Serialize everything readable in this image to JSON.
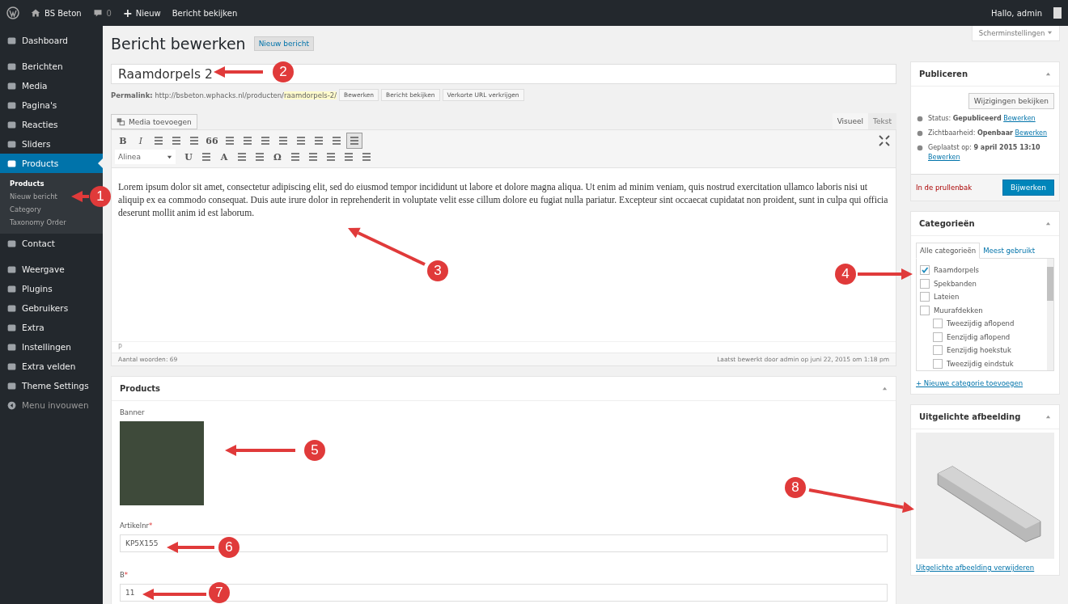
{
  "admin_bar": {
    "site": "BS Beton",
    "comments": "0",
    "plus": "+",
    "new": "Nieuw",
    "view": "Bericht bekijken",
    "greeting": "Hallo, admin"
  },
  "sidebar": {
    "items": [
      {
        "label": "Dashboard",
        "selected": false
      },
      {
        "label": "Berichten",
        "selected": false
      },
      {
        "label": "Media",
        "selected": false
      },
      {
        "label": "Pagina's",
        "selected": false
      },
      {
        "label": "Reacties",
        "selected": false
      },
      {
        "label": "Sliders",
        "selected": false
      },
      {
        "label": "Products",
        "selected": true,
        "children": [
          {
            "label": "Products",
            "selected": true
          },
          {
            "label": "Nieuw bericht",
            "selected": false
          },
          {
            "label": "Category",
            "selected": false
          },
          {
            "label": "Taxonomy Order",
            "selected": false
          }
        ]
      },
      {
        "label": "Contact",
        "selected": false
      },
      {
        "label": "Weergave",
        "selected": false
      },
      {
        "label": "Plugins",
        "selected": false
      },
      {
        "label": "Gebruikers",
        "selected": false
      },
      {
        "label": "Extra",
        "selected": false
      },
      {
        "label": "Instellingen",
        "selected": false
      },
      {
        "label": "Extra velden",
        "selected": false
      },
      {
        "label": "Theme Settings",
        "selected": false
      }
    ],
    "collapse": "Menu invouwen"
  },
  "screen_options": "Scherminstellingen",
  "page_title": "Bericht bewerken",
  "new_post_button": "Nieuw bericht",
  "post_title": "Raamdorpels 2",
  "permalink": {
    "label": "Permalink:",
    "base": "http://bsbeton.wphacks.nl/producten/",
    "slug": "raamdorpels-2/",
    "buttons": [
      "Bewerken",
      "Bericht bekijken",
      "Verkorte URL verkrijgen"
    ]
  },
  "media_button": "Media toevoegen",
  "editor_tabs": [
    {
      "label": "Visueel",
      "selected": true
    },
    {
      "label": "Tekst",
      "selected": false
    }
  ],
  "toolbar_rows": [
    [
      {
        "kind": "glyph",
        "label": "B",
        "pressed": false
      },
      {
        "kind": "glyph",
        "label": "I",
        "pressed": false
      },
      {
        "kind": "icon",
        "pressed": false
      },
      {
        "kind": "icon",
        "pressed": false
      },
      {
        "kind": "icon",
        "pressed": false
      },
      {
        "kind": "glyph",
        "label": "66",
        "pressed": false
      },
      {
        "kind": "icon",
        "pressed": false
      },
      {
        "kind": "icon",
        "pressed": false
      },
      {
        "kind": "icon",
        "pressed": false
      },
      {
        "kind": "icon",
        "pressed": false
      },
      {
        "kind": "icon",
        "pressed": false
      },
      {
        "kind": "icon",
        "pressed": false
      },
      {
        "kind": "icon",
        "pressed": false
      },
      {
        "kind": "icon",
        "pressed": true
      }
    ],
    [
      {
        "kind": "select",
        "label": "Alinea"
      },
      {
        "kind": "glyph",
        "label": "U",
        "pressed": false
      },
      {
        "kind": "icon",
        "pressed": false
      },
      {
        "kind": "glyph",
        "label": "A",
        "pressed": false
      },
      {
        "kind": "icon",
        "pressed": false
      },
      {
        "kind": "icon",
        "pressed": false
      },
      {
        "kind": "glyph",
        "label": "Ω",
        "pressed": false
      },
      {
        "kind": "icon",
        "pressed": false
      },
      {
        "kind": "icon",
        "pressed": false
      },
      {
        "kind": "icon",
        "pressed": false
      },
      {
        "kind": "icon",
        "pressed": false
      },
      {
        "kind": "icon",
        "pressed": false
      }
    ]
  ],
  "content": "Lorem ipsum dolor sit amet, consectetur adipiscing elit, sed do eiusmod tempor incididunt ut labore et dolore magna aliqua. Ut enim ad minim veniam, quis nostrud exercitation ullamco laboris nisi ut aliquip ex ea commodo consequat. Duis aute irure dolor in reprehenderit in voluptate velit esse cillum dolore eu fugiat nulla pariatur. Excepteur sint occaecat cupidatat non proident, sunt in culpa qui officia deserunt mollit anim id est laborum.",
  "editor_path": "P",
  "word_count": "Aantal woorden: 69",
  "last_edited": "Laatst bewerkt door admin op juni 22, 2015 om 1:18 pm",
  "products_box": {
    "title": "Products",
    "banner_label": "Banner",
    "fields": [
      {
        "label": "Artikelnr",
        "required_mark": "*",
        "value": "KP5X155"
      },
      {
        "label": "B",
        "required_mark": "*",
        "value": "11"
      }
    ]
  },
  "publish_box": {
    "title": "Publiceren",
    "preview": "Wijzigingen bekijken",
    "rows": [
      {
        "label": "Status:",
        "value": "Gepubliceerd",
        "link": "Bewerken"
      },
      {
        "label": "Zichtbaarheid:",
        "value": "Openbaar",
        "link": "Bewerken"
      },
      {
        "label": "Geplaatst op:",
        "value": "9 april 2015 13:10",
        "link": "Bewerken"
      }
    ],
    "trash": "In de prullenbak",
    "update": "Bijwerken"
  },
  "categories_box": {
    "title": "Categorieën",
    "tabs": [
      {
        "label": "Alle categorieën",
        "selected": true
      },
      {
        "label": "Meest gebruikt",
        "selected": false
      }
    ],
    "items": [
      {
        "label": "Raamdorpels",
        "checked": true
      },
      {
        "label": "Spekbanden",
        "checked": false
      },
      {
        "label": "Lateien",
        "checked": false
      },
      {
        "label": "Muurafdekken",
        "checked": false,
        "children": [
          {
            "label": "Tweezijdig aflopend",
            "checked": false
          },
          {
            "label": "Eenzijdig aflopend",
            "checked": false
          },
          {
            "label": "Eenzijdig hoekstuk",
            "checked": false
          },
          {
            "label": "Tweezijdig eindstuk",
            "checked": false
          }
        ]
      }
    ],
    "add_link": "+ Nieuwe categorie toevoegen"
  },
  "featured_box": {
    "title": "Uitgelichte afbeelding",
    "remove_link": "Uitgelichte afbeelding verwijderen"
  },
  "annotations": [
    {
      "number": "1"
    },
    {
      "number": "2"
    },
    {
      "number": "3"
    },
    {
      "number": "4"
    },
    {
      "number": "5"
    },
    {
      "number": "6"
    },
    {
      "number": "7"
    },
    {
      "number": "8"
    }
  ]
}
